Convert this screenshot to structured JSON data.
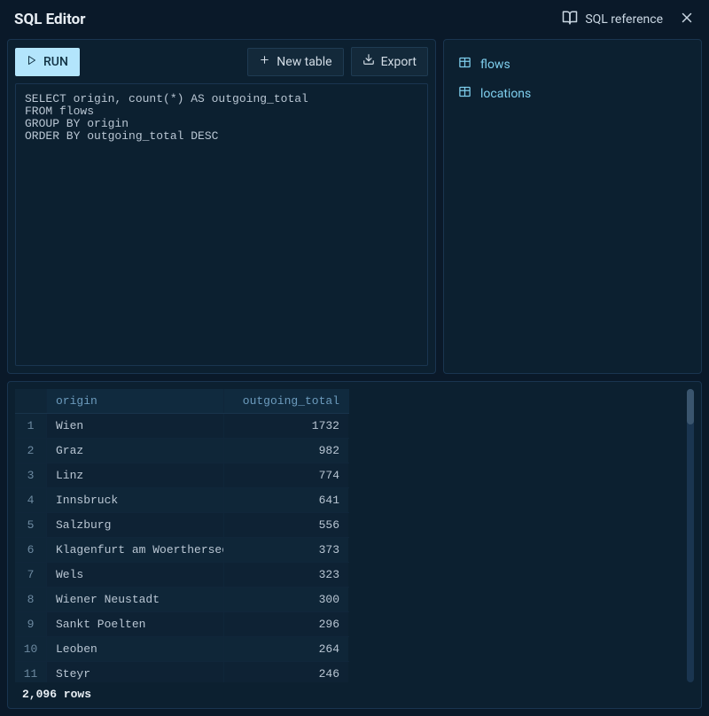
{
  "header": {
    "title": "SQL Editor",
    "reference_label": "SQL reference"
  },
  "toolbar": {
    "run_label": "RUN",
    "new_table_label": "New table",
    "export_label": "Export"
  },
  "editor": {
    "sql": "SELECT origin, count(*) AS outgoing_total\nFROM flows\nGROUP BY origin\nORDER BY outgoing_total DESC"
  },
  "tables": [
    {
      "name": "flows"
    },
    {
      "name": "locations"
    }
  ],
  "results": {
    "columns": [
      "origin",
      "outgoing_total"
    ],
    "rows": [
      {
        "idx": 1,
        "origin": "Wien",
        "outgoing_total": 1732
      },
      {
        "idx": 2,
        "origin": "Graz",
        "outgoing_total": 982
      },
      {
        "idx": 3,
        "origin": "Linz",
        "outgoing_total": 774
      },
      {
        "idx": 4,
        "origin": "Innsbruck",
        "outgoing_total": 641
      },
      {
        "idx": 5,
        "origin": "Salzburg",
        "outgoing_total": 556
      },
      {
        "idx": 6,
        "origin": "Klagenfurt am Woerthersee",
        "outgoing_total": 373
      },
      {
        "idx": 7,
        "origin": "Wels",
        "outgoing_total": 323
      },
      {
        "idx": 8,
        "origin": "Wiener Neustadt",
        "outgoing_total": 300
      },
      {
        "idx": 9,
        "origin": "Sankt Poelten",
        "outgoing_total": 296
      },
      {
        "idx": 10,
        "origin": "Leoben",
        "outgoing_total": 264
      },
      {
        "idx": 11,
        "origin": "Steyr",
        "outgoing_total": 246
      }
    ],
    "status": "2,096 rows"
  }
}
